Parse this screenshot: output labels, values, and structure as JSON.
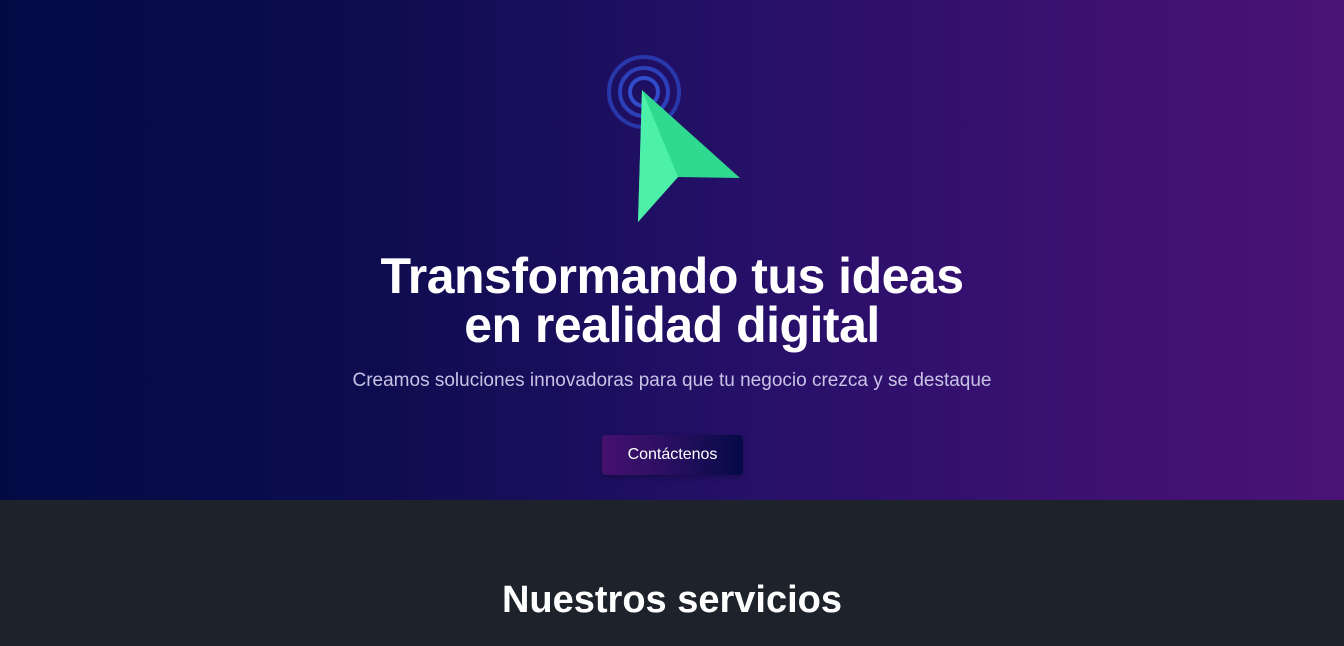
{
  "hero": {
    "icon": "cursor-click-icon",
    "title_line1": "Transformando tus ideas",
    "title_line2": "en realidad digital",
    "subtitle": "Creamos soluciones innovadoras para que tu negocio crezca y se destaque",
    "cta_label": "Contáctenos"
  },
  "services": {
    "title": "Nuestros servicios"
  },
  "colors": {
    "hero_gradient_start": "#030b45",
    "hero_gradient_end": "#4a1276",
    "cursor_green": "#2fd98f",
    "ring_blue": "#2a3fb8",
    "services_bg": "#1e232b"
  }
}
